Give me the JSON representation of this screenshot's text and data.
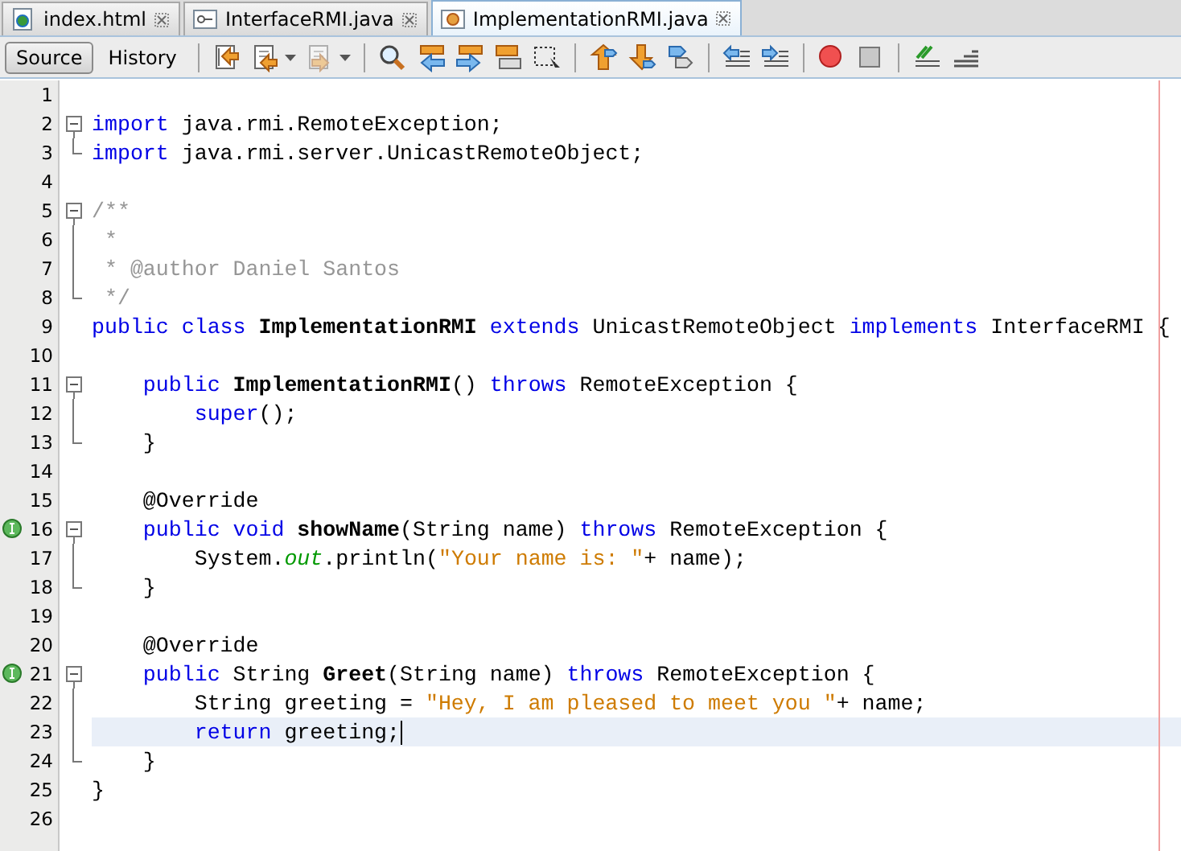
{
  "tabs": [
    {
      "label": "index.html",
      "kind": "html",
      "selected": false
    },
    {
      "label": "InterfaceRMI.java",
      "kind": "interface",
      "selected": false
    },
    {
      "label": "ImplementationRMI.java",
      "kind": "class",
      "selected": true
    }
  ],
  "toolbar": {
    "modes": [
      {
        "label": "Source",
        "selected": true
      },
      {
        "label": "History",
        "selected": false
      }
    ],
    "icons": [
      {
        "kind": "separator"
      },
      {
        "kind": "jump",
        "disabled": false
      },
      {
        "kind": "back",
        "disabled": false,
        "dropdown": true
      },
      {
        "kind": "forward",
        "disabled": true,
        "dropdown": true
      },
      {
        "kind": "separator"
      },
      {
        "kind": "find",
        "disabled": false
      },
      {
        "kind": "find-prev",
        "disabled": false
      },
      {
        "kind": "find-next",
        "disabled": false
      },
      {
        "kind": "highlight",
        "disabled": false
      },
      {
        "kind": "select-rect",
        "disabled": false
      },
      {
        "kind": "separator"
      },
      {
        "kind": "prev-bookmark",
        "disabled": false
      },
      {
        "kind": "next-bookmark",
        "disabled": false
      },
      {
        "kind": "toggle-bookmark",
        "disabled": false
      },
      {
        "kind": "separator"
      },
      {
        "kind": "shift-left",
        "disabled": false
      },
      {
        "kind": "shift-right",
        "disabled": false
      },
      {
        "kind": "separator"
      },
      {
        "kind": "record",
        "disabled": false
      },
      {
        "kind": "stop",
        "disabled": false
      },
      {
        "kind": "separator"
      },
      {
        "kind": "comment",
        "disabled": false
      },
      {
        "kind": "uncomment",
        "disabled": false
      }
    ]
  },
  "editor": {
    "lines": [
      {
        "number": "1",
        "kind": "plain"
      },
      {
        "number": "2",
        "kind": "fold-start",
        "tokens": [
          {
            "t": "import",
            "kind": "keyword"
          },
          {
            "t": " java.rmi.RemoteException;",
            "kind": "plain"
          }
        ]
      },
      {
        "number": "3",
        "kind": "fold-end",
        "tokens": [
          {
            "t": "import",
            "kind": "keyword"
          },
          {
            "t": " java.rmi.server.UnicastRemoteObject;",
            "kind": "plain"
          }
        ]
      },
      {
        "number": "4",
        "kind": "plain"
      },
      {
        "number": "5",
        "kind": "fold-start",
        "tokens": [
          {
            "t": "/**",
            "kind": "comment"
          }
        ]
      },
      {
        "number": "6",
        "kind": "fold-line",
        "tokens": [
          {
            "t": " *",
            "kind": "comment"
          }
        ]
      },
      {
        "number": "7",
        "kind": "fold-line",
        "tokens": [
          {
            "t": " * @author Daniel Santos",
            "kind": "comment"
          }
        ]
      },
      {
        "number": "8",
        "kind": "fold-end",
        "tokens": [
          {
            "t": " */",
            "kind": "comment"
          }
        ]
      },
      {
        "number": "9",
        "kind": "plain",
        "tokens": [
          {
            "t": "public class ",
            "kind": "keyword"
          },
          {
            "t": "ImplementationRMI ",
            "kind": "declaration"
          },
          {
            "t": "extends",
            "kind": "keyword"
          },
          {
            "t": " UnicastRemoteObject ",
            "kind": "plain"
          },
          {
            "t": "implements",
            "kind": "keyword"
          },
          {
            "t": " InterfaceRMI {",
            "kind": "plain"
          }
        ]
      },
      {
        "number": "10",
        "kind": "plain"
      },
      {
        "number": "11",
        "kind": "fold-start",
        "tokens": [
          {
            "t": "    public ",
            "kind": "keyword"
          },
          {
            "t": "ImplementationRMI",
            "kind": "declaration"
          },
          {
            "t": "() ",
            "kind": "plain"
          },
          {
            "t": "throws",
            "kind": "keyword"
          },
          {
            "t": " RemoteException {",
            "kind": "plain"
          }
        ]
      },
      {
        "number": "12",
        "kind": "fold-line",
        "tokens": [
          {
            "t": "        super",
            "kind": "keyword"
          },
          {
            "t": "();",
            "kind": "plain"
          }
        ]
      },
      {
        "number": "13",
        "kind": "fold-end",
        "tokens": [
          {
            "t": "    }",
            "kind": "plain"
          }
        ]
      },
      {
        "number": "14",
        "kind": "plain"
      },
      {
        "number": "15",
        "kind": "plain",
        "tokens": [
          {
            "t": "    @Override",
            "kind": "plain"
          }
        ]
      },
      {
        "number": "16",
        "kind": "fold-start",
        "implements_marker": true,
        "tokens": [
          {
            "t": "    public void ",
            "kind": "keyword"
          },
          {
            "t": "showName",
            "kind": "declaration"
          },
          {
            "t": "(String name) ",
            "kind": "plain"
          },
          {
            "t": "throws",
            "kind": "keyword"
          },
          {
            "t": " RemoteException {",
            "kind": "plain"
          }
        ]
      },
      {
        "number": "17",
        "kind": "fold-line",
        "tokens": [
          {
            "t": "        System.",
            "kind": "plain"
          },
          {
            "t": "out",
            "kind": "field"
          },
          {
            "t": ".println(",
            "kind": "plain"
          },
          {
            "t": "\"Your name is: \"",
            "kind": "string"
          },
          {
            "t": "+ name);",
            "kind": "plain"
          }
        ]
      },
      {
        "number": "18",
        "kind": "fold-end",
        "tokens": [
          {
            "t": "    }",
            "kind": "plain"
          }
        ]
      },
      {
        "number": "19",
        "kind": "plain"
      },
      {
        "number": "20",
        "kind": "plain",
        "tokens": [
          {
            "t": "    @Override",
            "kind": "plain"
          }
        ]
      },
      {
        "number": "21",
        "kind": "fold-start",
        "implements_marker": true,
        "tokens": [
          {
            "t": "    public",
            "kind": "keyword"
          },
          {
            "t": " String ",
            "kind": "plain"
          },
          {
            "t": "Greet",
            "kind": "declaration"
          },
          {
            "t": "(String name) ",
            "kind": "plain"
          },
          {
            "t": "throws",
            "kind": "keyword"
          },
          {
            "t": " RemoteException {",
            "kind": "plain"
          }
        ]
      },
      {
        "number": "22",
        "kind": "fold-line",
        "tokens": [
          {
            "t": "        String greeting = ",
            "kind": "plain"
          },
          {
            "t": "\"Hey, I am pleased to meet you \"",
            "kind": "string"
          },
          {
            "t": "+ name;",
            "kind": "plain"
          }
        ]
      },
      {
        "number": "23",
        "kind": "fold-line",
        "current": true,
        "tokens": [
          {
            "t": "        return",
            "kind": "keyword"
          },
          {
            "t": " greeting;",
            "kind": "plain"
          }
        ]
      },
      {
        "number": "24",
        "kind": "fold-end",
        "tokens": [
          {
            "t": "    }",
            "kind": "plain"
          }
        ]
      },
      {
        "number": "25",
        "kind": "plain",
        "tokens": [
          {
            "t": "}",
            "kind": "plain"
          }
        ]
      },
      {
        "number": "26",
        "kind": "plain"
      }
    ]
  }
}
